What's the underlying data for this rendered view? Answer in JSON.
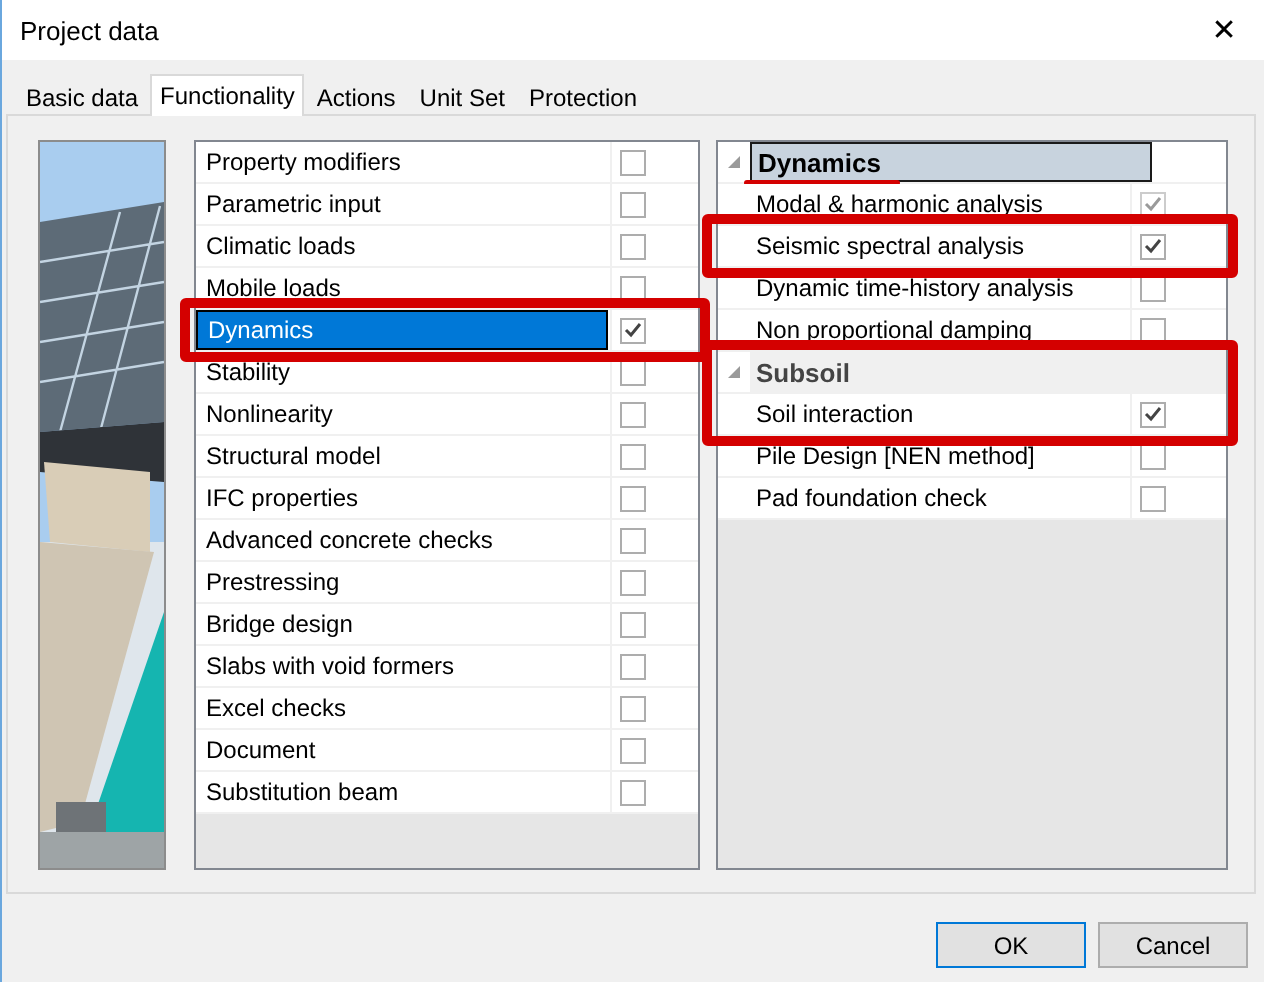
{
  "window": {
    "title": "Project data",
    "close": "✕"
  },
  "tabs": [
    {
      "label": "Basic data",
      "selected": false
    },
    {
      "label": "Functionality",
      "selected": true
    },
    {
      "label": "Actions",
      "selected": false
    },
    {
      "label": "Unit Set",
      "selected": false
    },
    {
      "label": "Protection",
      "selected": false
    }
  ],
  "modules": [
    {
      "label": "Property modifiers",
      "checked": false,
      "selected": false,
      "highlighted": false
    },
    {
      "label": "Parametric input",
      "checked": false,
      "selected": false,
      "highlighted": false
    },
    {
      "label": "Climatic loads",
      "checked": false,
      "selected": false,
      "highlighted": false
    },
    {
      "label": "Mobile loads",
      "checked": false,
      "selected": false,
      "highlighted": false
    },
    {
      "label": "Dynamics",
      "checked": true,
      "selected": true,
      "highlighted": true
    },
    {
      "label": "Stability",
      "checked": false,
      "selected": false,
      "highlighted": false
    },
    {
      "label": "Nonlinearity",
      "checked": false,
      "selected": false,
      "highlighted": false
    },
    {
      "label": "Structural model",
      "checked": false,
      "selected": false,
      "highlighted": false
    },
    {
      "label": "IFC properties",
      "checked": false,
      "selected": false,
      "highlighted": false
    },
    {
      "label": "Advanced concrete checks",
      "checked": false,
      "selected": false,
      "highlighted": false
    },
    {
      "label": "Prestressing",
      "checked": false,
      "selected": false,
      "highlighted": false
    },
    {
      "label": "Bridge design",
      "checked": false,
      "selected": false,
      "highlighted": false
    },
    {
      "label": "Slabs with void formers",
      "checked": false,
      "selected": false,
      "highlighted": false
    },
    {
      "label": "Excel checks",
      "checked": false,
      "selected": false,
      "highlighted": false
    },
    {
      "label": "Document",
      "checked": false,
      "selected": false,
      "highlighted": false
    },
    {
      "label": "Substitution beam",
      "checked": false,
      "selected": false,
      "highlighted": false
    }
  ],
  "options": [
    {
      "title": "Dynamics",
      "selected": true,
      "expanded": true,
      "underlined": true,
      "highlighted": false,
      "items": [
        {
          "label": "Modal & harmonic analysis",
          "checked": true,
          "disabled": true,
          "highlighted": false
        },
        {
          "label": "Seismic spectral analysis",
          "checked": true,
          "disabled": false,
          "highlighted": true
        },
        {
          "label": "Dynamic time-history analysis",
          "checked": false,
          "disabled": false,
          "highlighted": false
        },
        {
          "label": "Non proportional damping",
          "checked": false,
          "disabled": false,
          "highlighted": false
        }
      ]
    },
    {
      "title": "Subsoil",
      "selected": false,
      "expanded": true,
      "underlined": false,
      "highlighted": true,
      "items": [
        {
          "label": "Soil interaction",
          "checked": true,
          "disabled": false,
          "highlighted": false
        },
        {
          "label": "Pile Design [NEN method]",
          "checked": false,
          "disabled": false,
          "highlighted": false
        },
        {
          "label": "Pad foundation check",
          "checked": false,
          "disabled": false,
          "highlighted": false
        }
      ]
    }
  ],
  "buttons": [
    {
      "label": "OK",
      "default": true
    },
    {
      "label": "Cancel",
      "default": false
    }
  ]
}
